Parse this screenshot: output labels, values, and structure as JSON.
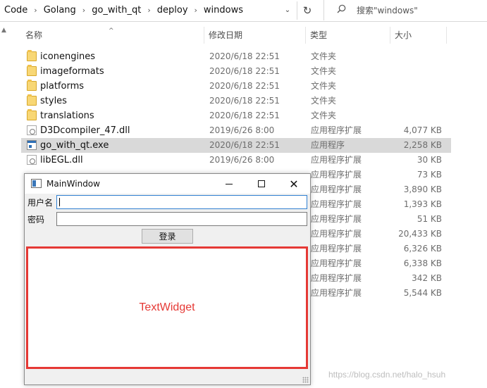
{
  "address_bar": {
    "breadcrumbs": [
      "Code",
      "Golang",
      "go_with_qt",
      "deploy",
      "windows"
    ],
    "separator": "›",
    "dropdown_glyph": "⌄",
    "refresh_glyph": "↻",
    "search_placeholder": "搜索\"windows\""
  },
  "columns": {
    "name": "名称",
    "modified": "修改日期",
    "type": "类型",
    "size": "大小",
    "sort_glyph": "^"
  },
  "files": [
    {
      "name": "iconengines",
      "date": "2020/6/18 22:51",
      "type": "文件夹",
      "size": "",
      "icon": "folder-icon"
    },
    {
      "name": "imageformats",
      "date": "2020/6/18 22:51",
      "type": "文件夹",
      "size": "",
      "icon": "folder-icon"
    },
    {
      "name": "platforms",
      "date": "2020/6/18 22:51",
      "type": "文件夹",
      "size": "",
      "icon": "folder-icon"
    },
    {
      "name": "styles",
      "date": "2020/6/18 22:51",
      "type": "文件夹",
      "size": "",
      "icon": "folder-icon"
    },
    {
      "name": "translations",
      "date": "2020/6/18 22:51",
      "type": "文件夹",
      "size": "",
      "icon": "folder-icon"
    },
    {
      "name": "D3Dcompiler_47.dll",
      "date": "2019/6/26 8:00",
      "type": "应用程序扩展",
      "size": "4,077 KB",
      "icon": "dll-file-icon"
    },
    {
      "name": "go_with_qt.exe",
      "date": "2020/6/18 22:51",
      "type": "应用程序",
      "size": "2,258 KB",
      "icon": "exe-file-icon",
      "selected": true
    },
    {
      "name": "libEGL.dll",
      "date": "2019/6/26 8:00",
      "type": "应用程序扩展",
      "size": "30 KB",
      "icon": "dll-file-icon"
    },
    {
      "name": "",
      "date": "",
      "type": "应用程序扩展",
      "size": "73 KB",
      "icon": ""
    },
    {
      "name": "",
      "date": "",
      "type": "应用程序扩展",
      "size": "3,890 KB",
      "icon": ""
    },
    {
      "name": "",
      "date": "",
      "type": "应用程序扩展",
      "size": "1,393 KB",
      "icon": ""
    },
    {
      "name": "",
      "date": "",
      "type": "应用程序扩展",
      "size": "51 KB",
      "icon": ""
    },
    {
      "name": "",
      "date": "",
      "type": "应用程序扩展",
      "size": "20,433 KB",
      "icon": ""
    },
    {
      "name": "",
      "date": "",
      "type": "应用程序扩展",
      "size": "6,326 KB",
      "icon": ""
    },
    {
      "name": "",
      "date": "",
      "type": "应用程序扩展",
      "size": "6,338 KB",
      "icon": ""
    },
    {
      "name": "",
      "date": "",
      "type": "应用程序扩展",
      "size": "342 KB",
      "icon": ""
    },
    {
      "name": "",
      "date": "",
      "type": "应用程序扩展",
      "size": "5,544 KB",
      "icon": ""
    }
  ],
  "main_window": {
    "title": "MainWindow",
    "minimize_icon": "minimize-icon",
    "maximize_icon": "maximize-icon",
    "close_glyph": "✕",
    "username_label": "用户名",
    "username_value": "",
    "password_label": "密码",
    "password_value": "",
    "login_button": "登录",
    "text_widget_label": "TextWidget",
    "accent_color": "#e53935"
  },
  "watermark": "https://blog.csdn.net/halo_hsuh"
}
